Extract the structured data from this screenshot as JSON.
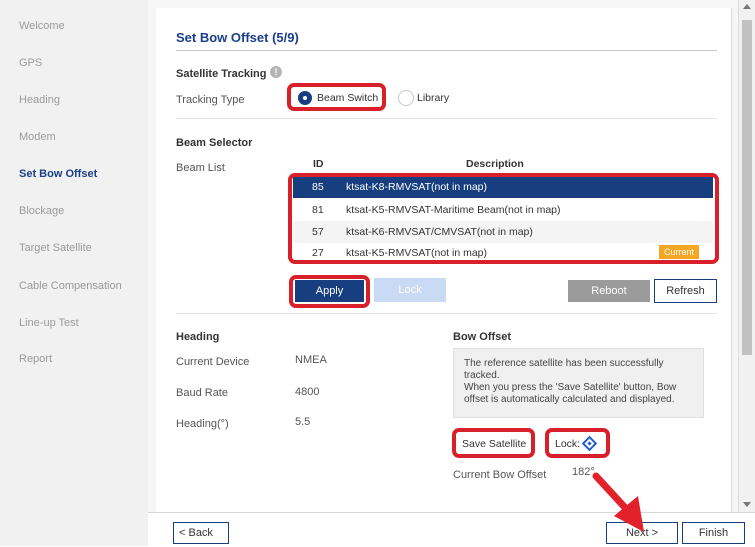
{
  "sidebar": {
    "items": [
      {
        "label": "Welcome"
      },
      {
        "label": "GPS"
      },
      {
        "label": "Heading"
      },
      {
        "label": "Modem"
      },
      {
        "label": "Set Bow Offset"
      },
      {
        "label": "Blockage"
      },
      {
        "label": "Target Satellite"
      },
      {
        "label": "Cable Compensation"
      },
      {
        "label": "Line-up Test"
      },
      {
        "label": "Report"
      }
    ]
  },
  "page": {
    "title": "Set Bow Offset (5/9)"
  },
  "tracking": {
    "section_label": "Satellite Tracking",
    "type_label": "Tracking Type",
    "options": [
      "Beam Switch",
      "Library"
    ],
    "selected": "Beam Switch"
  },
  "beam": {
    "section_label": "Beam Selector",
    "list_label": "Beam List",
    "headers": {
      "id": "ID",
      "description": "Description"
    },
    "rows": [
      {
        "id": "85",
        "description": "ktsat-K8-RMVSAT(not in map)",
        "selected": true
      },
      {
        "id": "81",
        "description": "ktsat-K5-RMVSAT-Maritime Beam(not in map)"
      },
      {
        "id": "57",
        "description": "ktsat-K6-RMVSAT/CMVSAT(not in map)"
      },
      {
        "id": "27",
        "description": "ktsat-K5-RMVSAT(not in map)",
        "badge": "Current"
      }
    ]
  },
  "buttons": {
    "apply": "Apply",
    "lock": "Lock",
    "reboot": "Reboot",
    "refresh": "Refresh",
    "back": "< Back",
    "next": "Next >",
    "finish": "Finish",
    "save_satellite": "Save Satellite",
    "lock_toggle": "Lock:"
  },
  "heading": {
    "section_label": "Heading",
    "fields": [
      {
        "label": "Current Device",
        "value": "NMEA"
      },
      {
        "label": "Baud Rate",
        "value": "4800"
      },
      {
        "label": "Heading(°)",
        "value": "5.5"
      }
    ]
  },
  "bow_offset": {
    "section_label": "Bow Offset",
    "message_1": "The reference satellite has been successfully tracked.",
    "message_2": "When you press the 'Save Satellite' button, Bow offset is automatically calculated and displayed.",
    "current_label": "Current Bow Offset",
    "current_value": "182°"
  },
  "colors": {
    "accent": "#173f80",
    "highlight_red": "#d8202a",
    "badge_orange": "#f5a623"
  }
}
